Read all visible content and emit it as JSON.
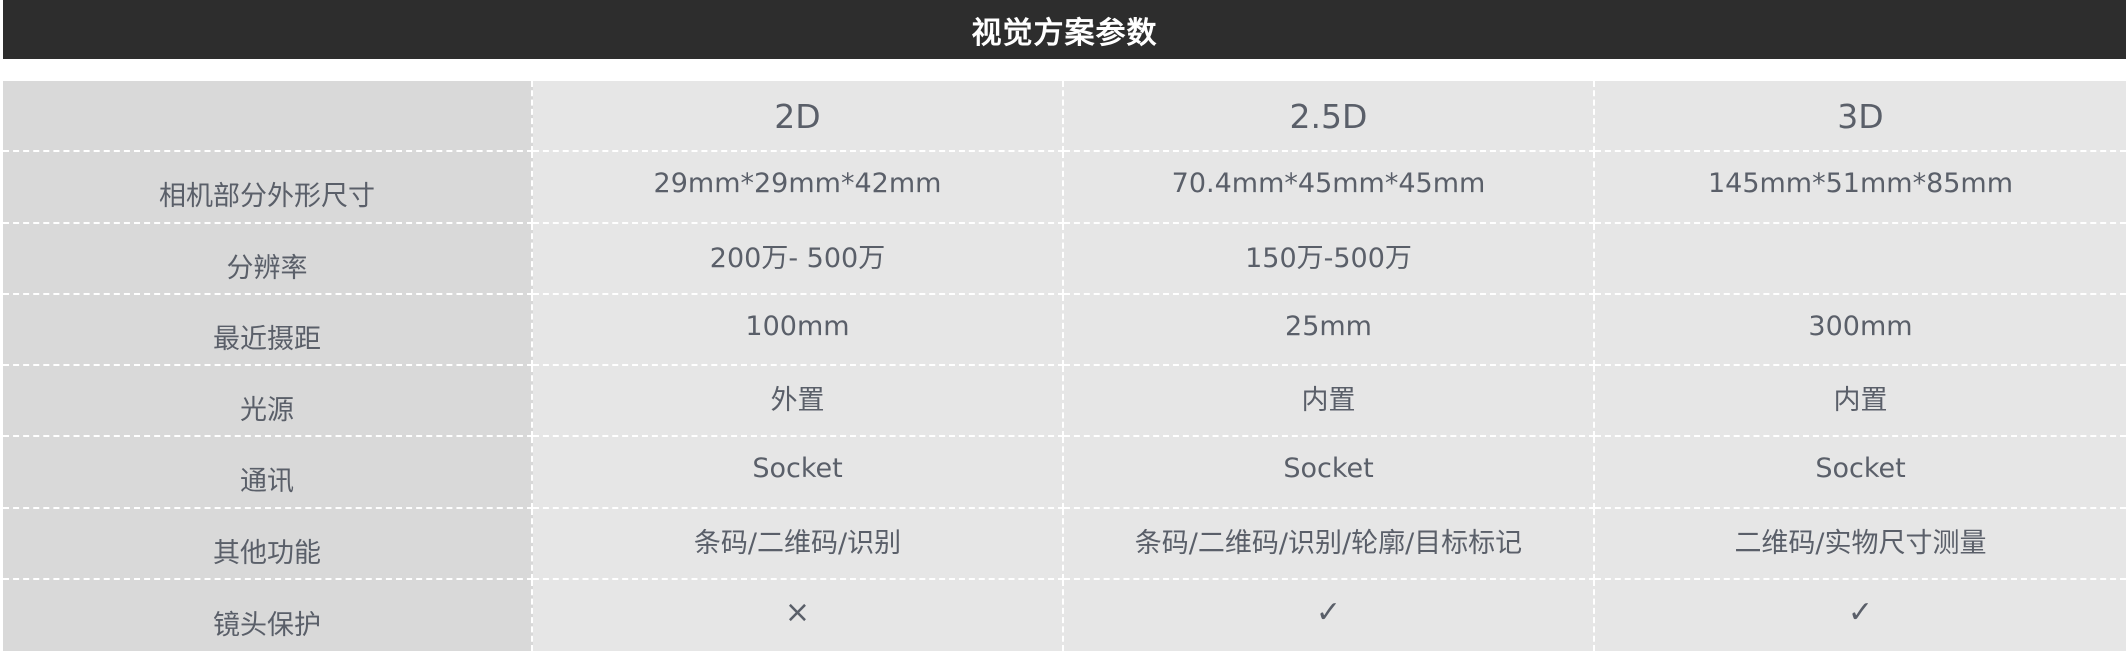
{
  "title": "视觉方案参数",
  "columns": [
    "",
    "2D",
    "2.5D",
    "3D"
  ],
  "rows": [
    {
      "label": "相机部分外形尺寸",
      "values": [
        "29mm*29mm*42mm",
        "70.4mm*45mm*45mm",
        "145mm*51mm*85mm"
      ]
    },
    {
      "label": "分辨率",
      "values": [
        "200万- 500万",
        "150万-500万",
        ""
      ]
    },
    {
      "label": "最近摄距",
      "values": [
        "100mm",
        "25mm",
        "300mm"
      ]
    },
    {
      "label": "光源",
      "values": [
        "外置",
        "内置",
        "内置"
      ]
    },
    {
      "label": "通讯",
      "values": [
        "Socket",
        "Socket",
        "Socket"
      ]
    },
    {
      "label": "其他功能",
      "values": [
        "条码/二维码/识别",
        "条码/二维码/识别/轮廓/目标标记",
        "二维码/实物尺寸测量"
      ]
    },
    {
      "label": "镜头保护",
      "values": [
        "×",
        "✓",
        "✓"
      ]
    }
  ],
  "colors": {
    "header_bg": "#2d2d2d",
    "header_text": "#ffffff",
    "label_bg": "#d9d9d9",
    "cell_bg": "#e6e6e6",
    "text": "#5a5f69"
  }
}
